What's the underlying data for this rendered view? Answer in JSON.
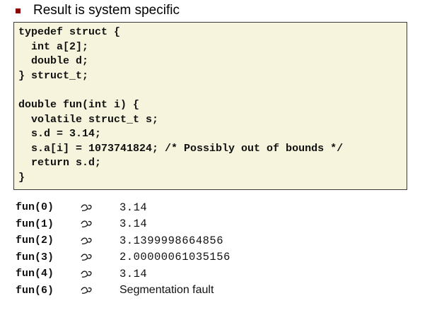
{
  "bullet": {
    "text": "Result is system specific",
    "marker_color": "#8b0000"
  },
  "code_box": {
    "background": "#f6f4dc",
    "lines": [
      "typedef struct {",
      "  int a[2];",
      "  double d;",
      "} struct_t;",
      "",
      "double fun(int i) {",
      "  volatile struct_t s;",
      "  s.d = 3.14;",
      "  s.a[i] = 1073741824; /* Possibly out of bounds */",
      "  return s.d;",
      "}"
    ]
  },
  "results": [
    {
      "call": "fun(0)",
      "symbol": "leads-to-icon",
      "value": "3.14",
      "style": "mono"
    },
    {
      "call": "fun(1)",
      "symbol": "leads-to-icon",
      "value": "3.14",
      "style": "mono"
    },
    {
      "call": "fun(2)",
      "symbol": "leads-to-icon",
      "value": "3.1399998664856",
      "style": "mono"
    },
    {
      "call": "fun(3)",
      "symbol": "leads-to-icon",
      "value": "2.00000061035156",
      "style": "mono"
    },
    {
      "call": "fun(4)",
      "symbol": "leads-to-icon",
      "value": "3.14",
      "style": "mono"
    },
    {
      "call": "fun(6)",
      "symbol": "leads-to-icon",
      "value": "Segmentation fault",
      "style": "text"
    }
  ]
}
